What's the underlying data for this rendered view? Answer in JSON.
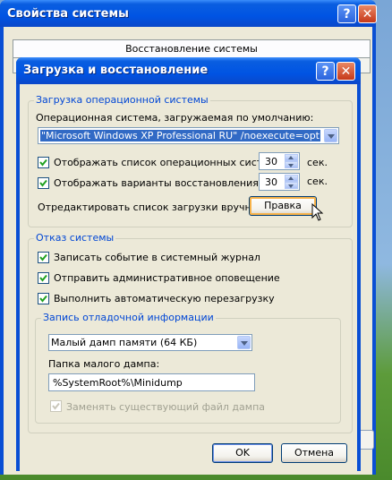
{
  "back_window": {
    "title": "Свойства системы",
    "tab_label": "Восстановление системы"
  },
  "dialog": {
    "title": "Загрузка и восстановление",
    "startup": {
      "legend": "Загрузка операционной системы",
      "default_os_label": "Операционная система, загружаемая по умолчанию:",
      "default_os_value": "\"Microsoft Windows XP Professional RU\" /noexecute=optin /fastdetect",
      "show_list_label": "Отображать список операционных систем:",
      "show_list_checked": true,
      "show_list_seconds": "30",
      "show_recovery_label": "Отображать варианты восстановления:",
      "show_recovery_checked": true,
      "show_recovery_seconds": "30",
      "seconds_unit": "сек.",
      "edit_label": "Отредактировать список загрузки вручную:",
      "edit_button": "Правка"
    },
    "failure": {
      "legend": "Отказ системы",
      "write_event_label": "Записать событие в системный журнал",
      "write_event_checked": true,
      "send_alert_label": "Отправить административное оповещение",
      "send_alert_checked": true,
      "auto_restart_label": "Выполнить автоматическую перезагрузку",
      "auto_restart_checked": true,
      "debug": {
        "legend": "Запись отладочной информации",
        "dump_type": "Малый дамп памяти (64 КБ)",
        "folder_label": "Папка малого дампа:",
        "folder_value": "%SystemRoot%\\Minidump",
        "overwrite_label": "Заменять существующий файл дампа",
        "overwrite_checked": true,
        "overwrite_enabled": false
      }
    },
    "ok_button": "OK",
    "cancel_button": "Отмена"
  },
  "colors": {
    "titlebar": "#0054e3",
    "dialog_bg": "#ece9d8",
    "group_legend": "#0046d5",
    "selection": "#316ac5"
  }
}
